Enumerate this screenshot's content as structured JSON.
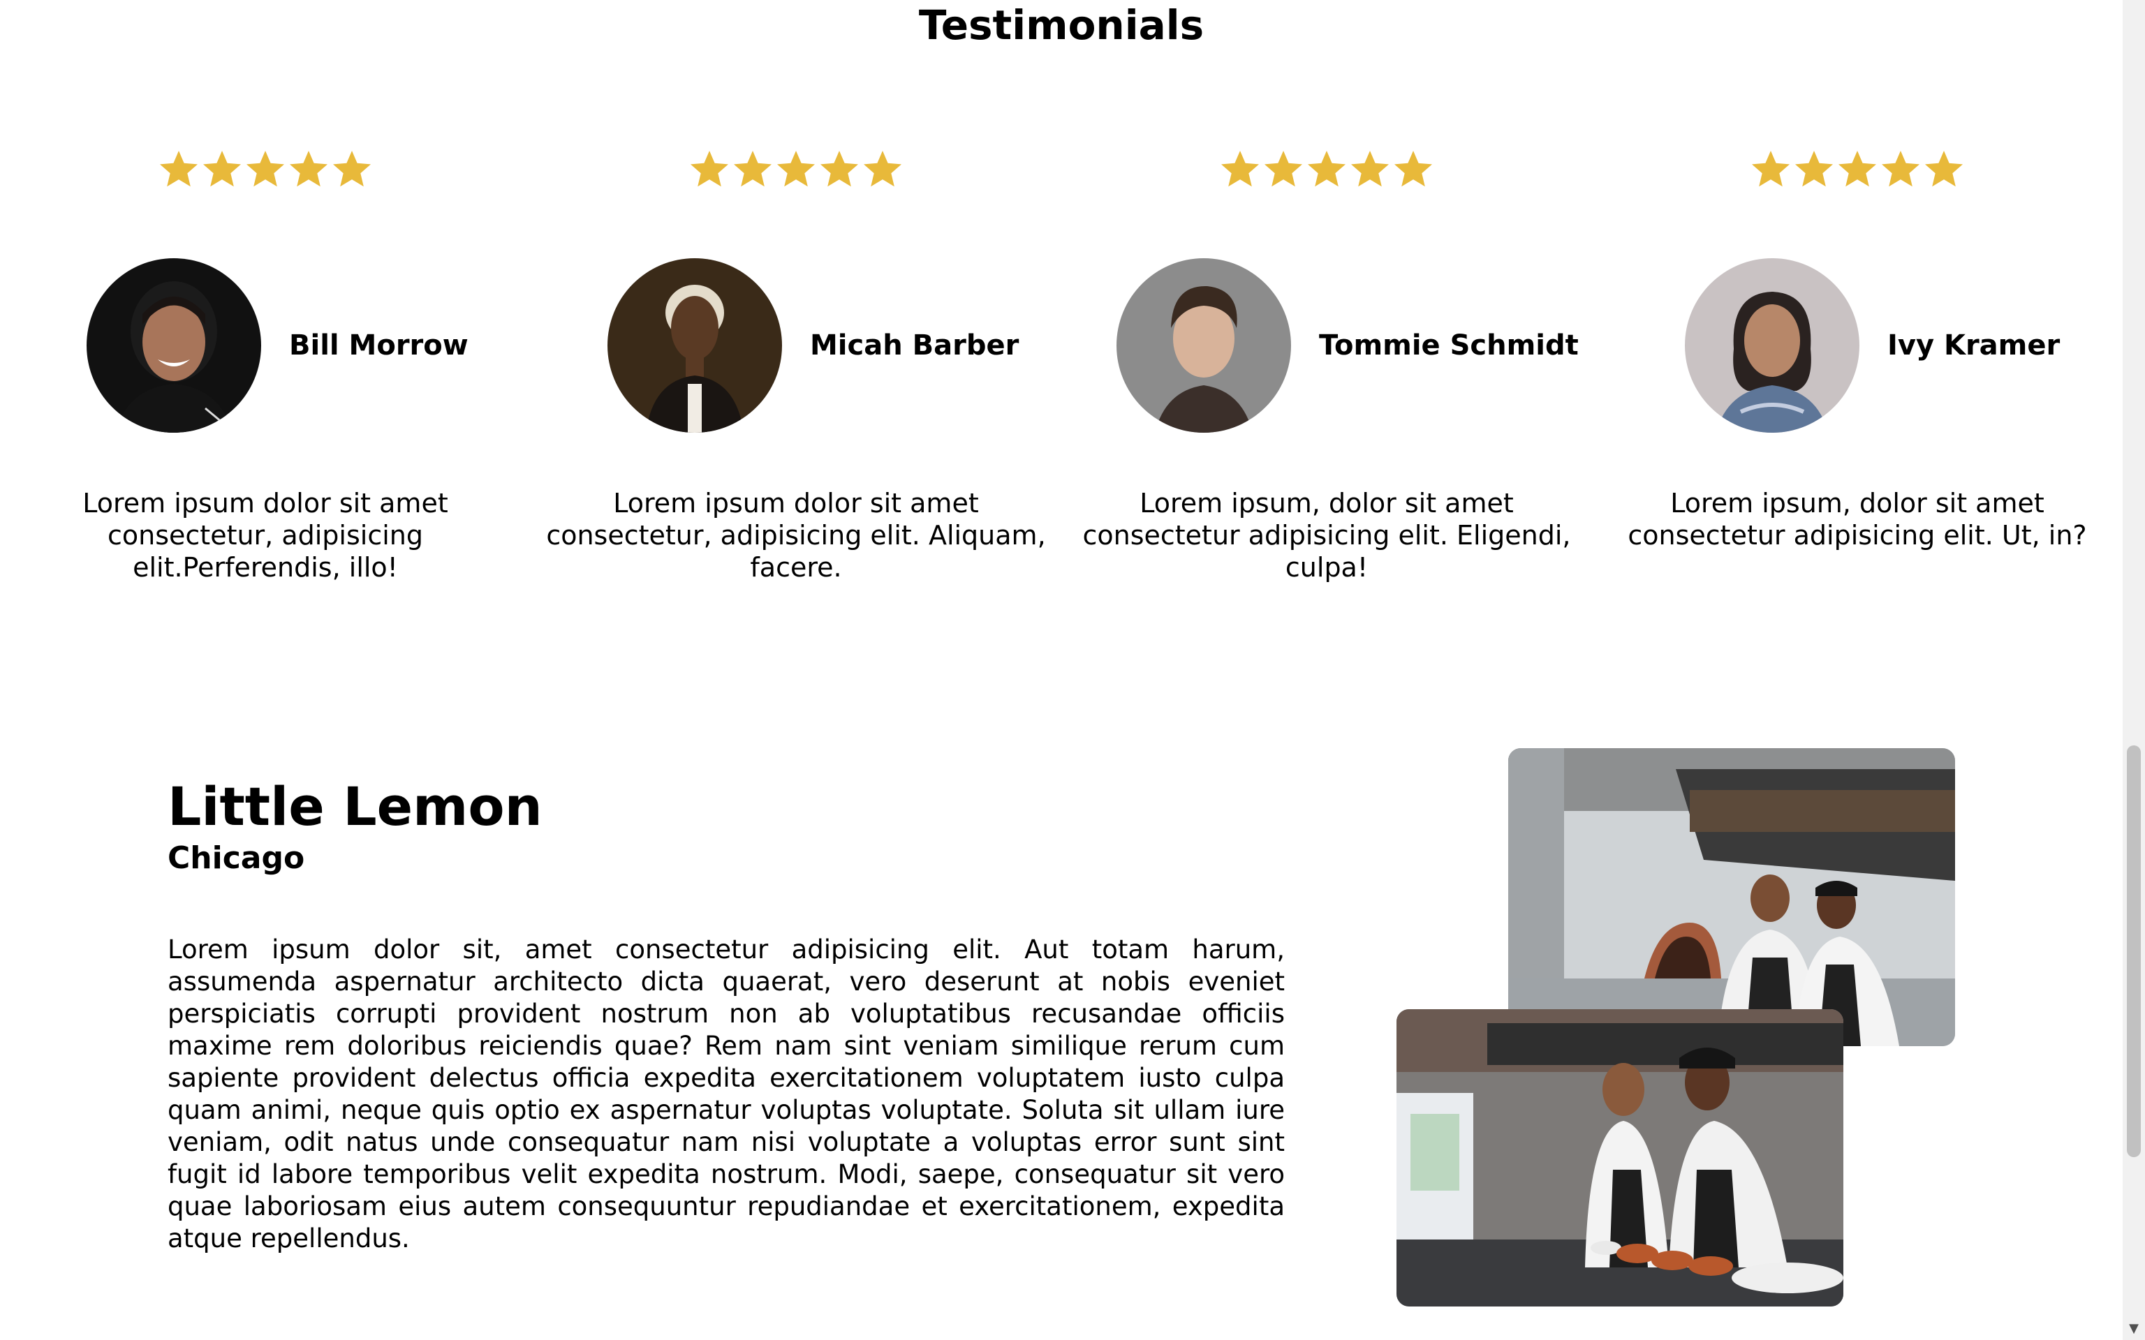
{
  "testimonials": {
    "title": "Testimonials",
    "star_color": "#e8b93a",
    "star_count": 5,
    "items": [
      {
        "name": "Bill Morrow",
        "rating": 5,
        "quote": "Lorem ipsum dolor sit amet consectetur, adipisicing elit.Perferendis, illo!",
        "avatar": "avatar-bill-morrow"
      },
      {
        "name": "Micah Barber",
        "rating": 5,
        "quote": "Lorem ipsum dolor sit amet consectetur, adipisicing elit. Aliquam, facere.",
        "avatar": "avatar-micah-barber"
      },
      {
        "name": "Tommie Schmidt",
        "rating": 5,
        "quote": "Lorem ipsum, dolor sit amet consectetur adipisicing elit. Eligendi, culpa!",
        "avatar": "avatar-tommie-schmidt"
      },
      {
        "name": "Ivy Kramer",
        "rating": 5,
        "quote": "Lorem ipsum, dolor sit amet consectetur adipisicing elit. Ut, in?",
        "avatar": "avatar-ivy-kramer"
      }
    ]
  },
  "about": {
    "title": "Little Lemon",
    "city": "Chicago",
    "description": "Lorem ipsum dolor sit, amet consectetur adipisicing elit. Aut totam harum, assumenda aspernatur architecto dicta quaerat, vero deserunt at nobis eveniet perspiciatis corrupti provident nostrum non ab voluptatibus recusandae officiis maxime rem doloribus reiciendis quae? Rem nam sint veniam similique rerum cum sapiente provident delectus officia expedita exercitationem voluptatem iusto culpa quam animi, neque quis optio ex aspernatur voluptas voluptate. Soluta sit ullam iure veniam, odit natus unde consequatur nam nisi voluptate a voluptas error sunt sint fugit id labore temporibus velit expedita nostrum. Modi, saepe, consequatur sit vero quae laboriosam eius autem consequuntur repudiandae et exercitationem, expedita atque repellendus.",
    "photos": [
      "chefs-kitchen-photo-1",
      "chefs-kitchen-photo-2"
    ]
  },
  "scrollbar": {
    "arrow_icon": "chevron-down-icon"
  }
}
